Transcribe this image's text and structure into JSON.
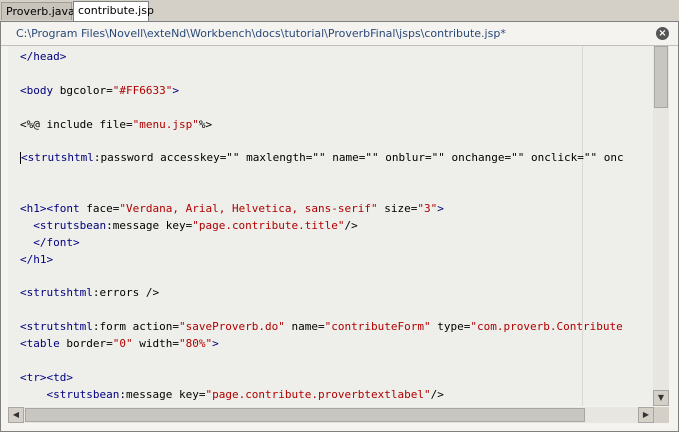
{
  "tabs": [
    {
      "label": "Proverb.java",
      "active": false
    },
    {
      "label": "contribute.jsp",
      "active": true
    }
  ],
  "editor": {
    "file_path": "C:\\Program Files\\Novell\\exteNd\\Workbench\\docs\\tutorial\\ProverbFinal\\jsps\\contribute.jsp*",
    "close_icon": "close-icon",
    "lines": [
      [
        [
          "t",
          "</head>"
        ]
      ],
      [],
      [
        [
          "t",
          "<body"
        ],
        [
          "p",
          " bgcolor="
        ],
        [
          "s",
          "\"#FF6633\""
        ],
        [
          "t",
          ">"
        ]
      ],
      [],
      [
        [
          "p",
          "<%@ include file="
        ],
        [
          "s",
          "\"menu.jsp\""
        ],
        [
          "p",
          "%>"
        ]
      ],
      [],
      [
        [
          "t",
          "<strutshtml"
        ],
        [
          "p",
          ":password accesskey=\"\" maxlength=\"\" name=\"\" onblur=\"\" onchange=\"\" onclick=\"\" onc"
        ]
      ],
      [],
      [],
      [
        [
          "t",
          "<h1><font"
        ],
        [
          "p",
          " face="
        ],
        [
          "s",
          "\"Verdana, Arial, Helvetica, sans-serif\""
        ],
        [
          "p",
          " size="
        ],
        [
          "s",
          "\"3\""
        ],
        [
          "t",
          ">"
        ]
      ],
      [
        [
          "p",
          "  "
        ],
        [
          "t",
          "<strutsbean"
        ],
        [
          "p",
          ":message key="
        ],
        [
          "s",
          "\"page.contribute.title\""
        ],
        [
          "p",
          "/>"
        ]
      ],
      [
        [
          "p",
          "  "
        ],
        [
          "t",
          "</font>"
        ]
      ],
      [
        [
          "t",
          "</h1>"
        ]
      ],
      [],
      [
        [
          "t",
          "<strutshtml"
        ],
        [
          "p",
          ":errors />"
        ]
      ],
      [],
      [
        [
          "t",
          "<strutshtml"
        ],
        [
          "p",
          ":form action="
        ],
        [
          "s",
          "\"saveProverb.do\""
        ],
        [
          "p",
          " name="
        ],
        [
          "s",
          "\"contributeForm\""
        ],
        [
          "p",
          " type="
        ],
        [
          "s",
          "\"com.proverb.Contribute"
        ]
      ],
      [
        [
          "t",
          "<table"
        ],
        [
          "p",
          " border="
        ],
        [
          "s",
          "\"0\""
        ],
        [
          "p",
          " width="
        ],
        [
          "s",
          "\"80%\""
        ],
        [
          "t",
          ">"
        ]
      ],
      [],
      [
        [
          "t",
          "<tr><td>"
        ]
      ],
      [
        [
          "p",
          "    "
        ],
        [
          "t",
          "<strutsbean"
        ],
        [
          "p",
          ":message key="
        ],
        [
          "s",
          "\"page.contribute.proverbtextlabel\""
        ],
        [
          "p",
          "/>"
        ]
      ]
    ]
  },
  "colors": {
    "tag": "#00007f",
    "string": "#b00000",
    "plain": "#000000"
  }
}
